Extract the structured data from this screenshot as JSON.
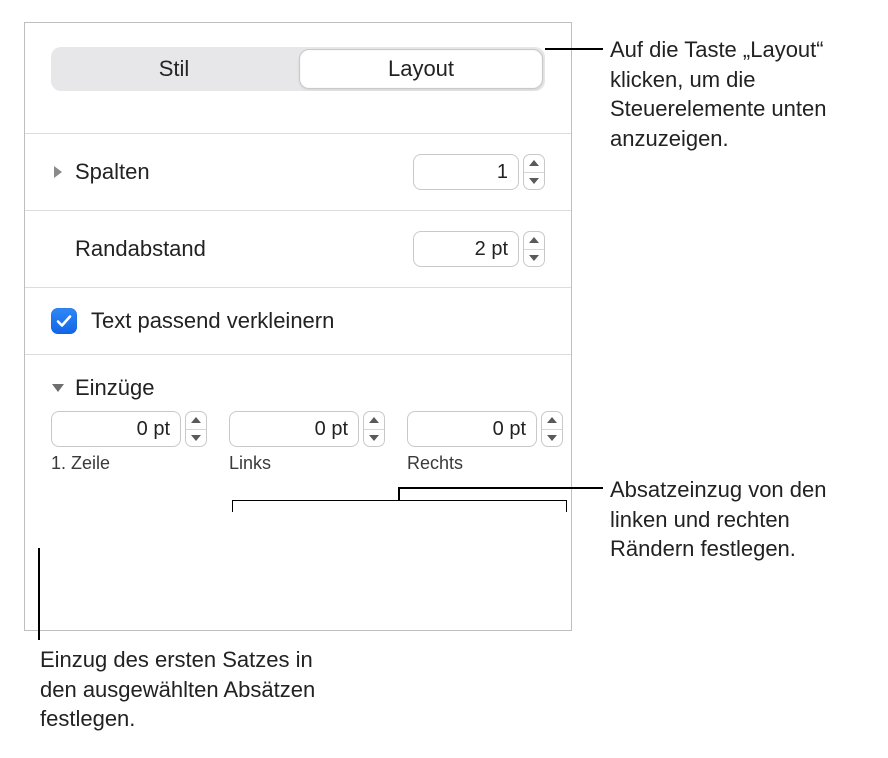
{
  "tabs": {
    "stil": "Stil",
    "layout": "Layout"
  },
  "spalten": {
    "label": "Spalten",
    "value": "1"
  },
  "randabstand": {
    "label": "Randabstand",
    "value": "2 pt"
  },
  "shrink": {
    "label": "Text passend verkleinern",
    "checked": true
  },
  "einzuege": {
    "heading": "Einzüge",
    "first": {
      "value": "0 pt",
      "label": "1. Zeile"
    },
    "left": {
      "value": "0 pt",
      "label": "Links"
    },
    "right": {
      "value": "0 pt",
      "label": "Rechts"
    }
  },
  "callouts": {
    "layout": "Auf die Taste „Layout“ klicken, um die Steuerelemente unten anzuzeigen.",
    "margins": "Absatzeinzug von den linken und rechten Rändern festlegen.",
    "firstline": "Einzug des ersten Satzes in den ausgewählten Absätzen festlegen."
  }
}
